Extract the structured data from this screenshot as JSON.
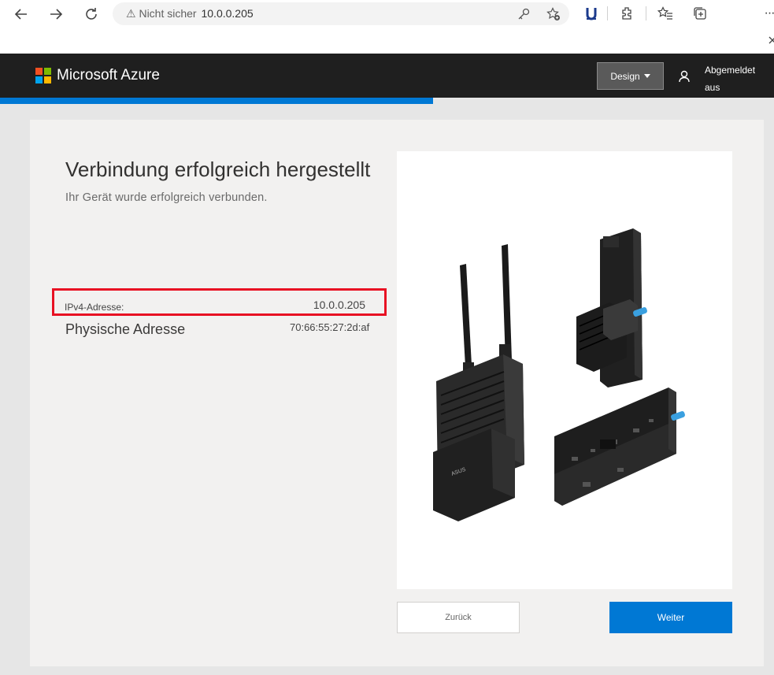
{
  "browser": {
    "address_security": "Nicht sicher",
    "address_url": "10.0.0.205"
  },
  "header": {
    "brand": "Microsoft Azure",
    "design_label": "Design",
    "user_status": "Abgemeldet aus",
    "logo_colors": [
      "#f25022",
      "#7fba00",
      "#00a4ef",
      "#ffb900"
    ]
  },
  "progress": {
    "value": 0.56,
    "color": "#0078d4"
  },
  "main": {
    "title": "Verbindung erfolgreich hergestellt",
    "subtitle": "Ihr Gerät wurde erfolgreich verbunden.",
    "ipv4_label": "IPv4-Adresse:",
    "ipv4_value": "10.0.0.205",
    "mac_label": "Physische Adresse",
    "mac_value": "70:66:55:27:2d:af",
    "back_label": "Zurück",
    "next_label": "Weiter",
    "device_label": "ASUS"
  }
}
